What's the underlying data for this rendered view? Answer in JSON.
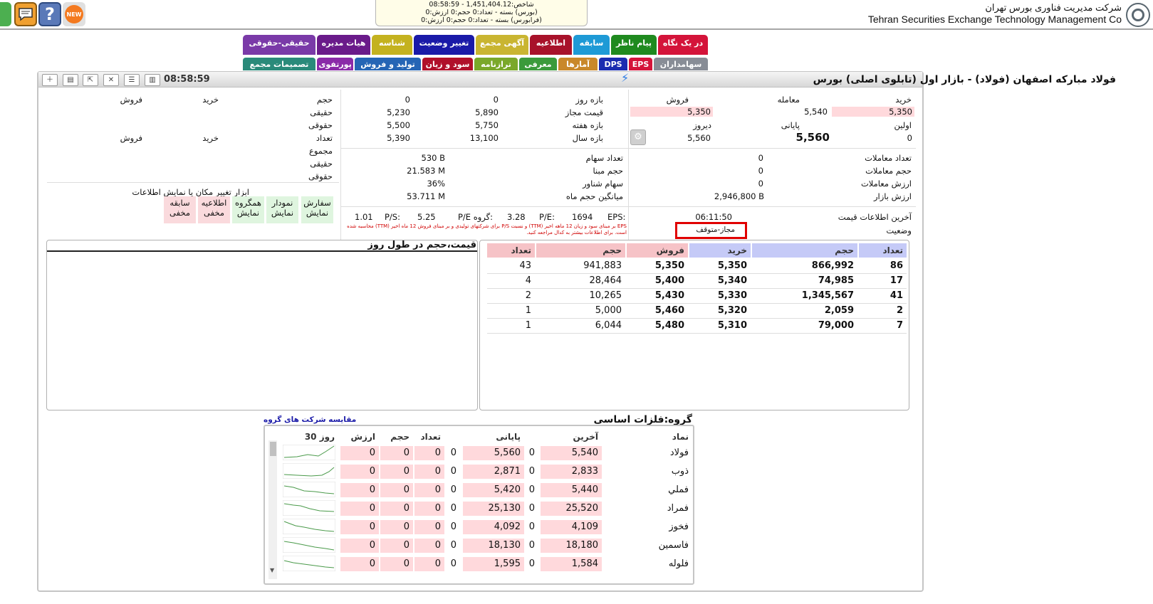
{
  "topbar": {
    "company_fa": "شرکت مدیریت فناوری بورس تهران",
    "company_en": "Tehran Securities Exchange Technology Management Co",
    "ticker_line1": "شاخص:1,451,404.12 - 08:58:59",
    "ticker_line2": "(بورس) بسته - تعداد:0 حجم:0 ارزش:0",
    "ticker_line3": "(فرابورس) بسته - تعداد:0 حجم:0 ارزش:0",
    "new_badge": "NEW",
    "help_label": "?"
  },
  "tabs_row1": [
    {
      "label": "در یک نگاه",
      "color": "#d4143a"
    },
    {
      "label": "پیام ناظر",
      "color": "#1f8a1f"
    },
    {
      "label": "سابقه",
      "color": "#1e9ad6"
    },
    {
      "label": "اطلاعیه",
      "color": "#a8122a"
    },
    {
      "label": "آگهی مجمع",
      "color": "#c9b531"
    },
    {
      "label": "تغییر وضعیت",
      "color": "#1a1aa8"
    },
    {
      "label": "شناسه",
      "color": "#c4b21f"
    },
    {
      "label": "هیات مدیره",
      "color": "#6a1b8a"
    },
    {
      "label": "حقیقی-حقوقی",
      "color": "#7a3aa8"
    }
  ],
  "tabs_row2": [
    {
      "label": "سهامداران",
      "color": "#888d96"
    },
    {
      "label": "EPS",
      "color": "#d4143a"
    },
    {
      "label": "DPS",
      "color": "#1a2cb0"
    },
    {
      "label": "آمارها",
      "color": "#c9882a"
    },
    {
      "label": "معرفی",
      "color": "#3b9a3b"
    },
    {
      "label": "ترازنامه",
      "color": "#7aa82a"
    },
    {
      "label": "سود و زیان",
      "color": "#b0102a"
    },
    {
      "label": "تولید و فروش",
      "color": "#2565b5"
    },
    {
      "label": "پورتفوی",
      "color": "#8a2aa8"
    },
    {
      "label": "تصمیمات مجمع",
      "color": "#2a8a7a"
    }
  ],
  "header": {
    "title": "فولاد مبارکه اصفهان (فولاد) - بازار اول (تابلوی اصلی) بورس",
    "time": "08:58:59"
  },
  "quote": {
    "buy_label": "خرید",
    "trade_label": "معامله",
    "sell_label": "فروش",
    "buy": "5,350",
    "trade": "5,540",
    "sell": "5,350",
    "first_label": "اولین",
    "last_label": "پایانی",
    "yesterday_label": "دیروز",
    "first": "0",
    "last": "5,560",
    "yesterday": "5,560"
  },
  "ranges": {
    "day_label": "بازه روز",
    "day_min": "0",
    "day_max": "0",
    "allowed_label": "قیمت مجاز",
    "allowed_min": "5,230",
    "allowed_max": "5,890",
    "week_label": "بازه هفته",
    "week_min": "5,500",
    "week_max": "5,750",
    "year_label": "بازه سال",
    "year_min": "5,390",
    "year_max": "13,100"
  },
  "stats": {
    "trades_count_label": "تعداد معاملات",
    "trades_count": "0",
    "trades_volume_label": "حجم معاملات",
    "trades_volume": "0",
    "trades_value_label": "ارزش معاملات",
    "trades_value": "0",
    "market_value_label": "ارزش بازار",
    "market_value": "2,946,800 B",
    "shares_label": "تعداد سهام",
    "shares": "530 B",
    "base_volume_label": "حجم مبنا",
    "base_volume": "21.583 M",
    "float_label": "سهام شناور",
    "float": "36%",
    "avg_month_label": "میانگین حجم ماه",
    "avg_month": "53.711 M"
  },
  "last_info": {
    "last_price_info_label": "آخرین اطلاعات قیمت",
    "last_price_info": "06:11:50",
    "status_label": "وضعیت",
    "status": "مجاز-متوقف"
  },
  "ratios": {
    "eps_label": "EPS:",
    "eps": "1694",
    "pe_label": "P/E:",
    "pe": "3.28",
    "group_pe_label": "P/E گروه:",
    "group_pe": "5.25",
    "ps_label": "P/S:",
    "ps": "1.01",
    "note": "EPS بر مبنای سود و زیان 12 ماهه اخیر (TTM) و نسبت P/S برای شرکتهای تولیدی و بر مبنای فروش 12 ماه اخیر (TTM) محاسبه شده است. برای اطلاعات بیشتر به کدال مراجعه کنید."
  },
  "people": {
    "volume_label": "حجم",
    "buy_label": "خرید",
    "sell_label": "فروش",
    "real_label": "حقیقی",
    "legal_label": "حقوقی",
    "count_label": "تعداد",
    "total_label": "مجموع"
  },
  "tools": {
    "title": "ابزار تغییر مکان یا نمایش اطلاعات",
    "items": [
      {
        "name": "سفارش",
        "state": "نمایش",
        "bg": "#dff5df"
      },
      {
        "name": "نمودار",
        "state": "نمایش",
        "bg": "#dff5df"
      },
      {
        "name": "همگروه",
        "state": "نمایش",
        "bg": "#dff5df"
      },
      {
        "name": "اطلاعیه",
        "state": "مخفی",
        "bg": "#fadadd"
      },
      {
        "name": "سابقه",
        "state": "مخفی",
        "bg": "#fadadd"
      }
    ]
  },
  "chart_panel": {
    "title": "قیمت،حجم در طول روز"
  },
  "orderbook": {
    "headers": [
      "تعداد",
      "حجم",
      "خرید",
      "فروش",
      "حجم",
      "تعداد"
    ],
    "rows": [
      [
        "86",
        "866,992",
        "5,350",
        "5,350",
        "941,883",
        "43"
      ],
      [
        "17",
        "74,985",
        "5,340",
        "5,400",
        "28,464",
        "4"
      ],
      [
        "41",
        "1,345,567",
        "5,330",
        "5,430",
        "10,265",
        "2"
      ],
      [
        "2",
        "2,059",
        "5,320",
        "5,460",
        "5,000",
        "1"
      ],
      [
        "7",
        "79,000",
        "5,310",
        "5,480",
        "6,044",
        "1"
      ]
    ]
  },
  "group": {
    "title": "گروه:فلزات اساسی",
    "compare_link": "مقایسه شرکت های گروه",
    "headers": {
      "symbol": "نماد",
      "last": "آخرین",
      "close": "پایانی",
      "count": "تعداد",
      "volume": "حجم",
      "value": "ارزش",
      "days30": "30 روز"
    },
    "rows": [
      {
        "symbol": "فولاد",
        "last": "5,540",
        "last_chg": "0",
        "close": "5,560",
        "close_chg": "0",
        "count": "0",
        "volume": "0",
        "value": "0"
      },
      {
        "symbol": "ذوب",
        "last": "2,833",
        "last_chg": "0",
        "close": "2,871",
        "close_chg": "0",
        "count": "0",
        "volume": "0",
        "value": "0"
      },
      {
        "symbol": "فملي",
        "last": "5,440",
        "last_chg": "0",
        "close": "5,420",
        "close_chg": "0",
        "count": "0",
        "volume": "0",
        "value": "0"
      },
      {
        "symbol": "فمراد",
        "last": "25,520",
        "last_chg": "0",
        "close": "25,130",
        "close_chg": "0",
        "count": "0",
        "volume": "0",
        "value": "0"
      },
      {
        "symbol": "فخوز",
        "last": "4,109",
        "last_chg": "0",
        "close": "4,092",
        "close_chg": "0",
        "count": "0",
        "volume": "0",
        "value": "0"
      },
      {
        "symbol": "فاسمین",
        "last": "18,180",
        "last_chg": "0",
        "close": "18,130",
        "close_chg": "0",
        "count": "0",
        "volume": "0",
        "value": "0"
      },
      {
        "symbol": "فلوله",
        "last": "1,584",
        "last_chg": "0",
        "close": "1,595",
        "close_chg": "0",
        "count": "0",
        "volume": "0",
        "value": "0"
      }
    ]
  }
}
